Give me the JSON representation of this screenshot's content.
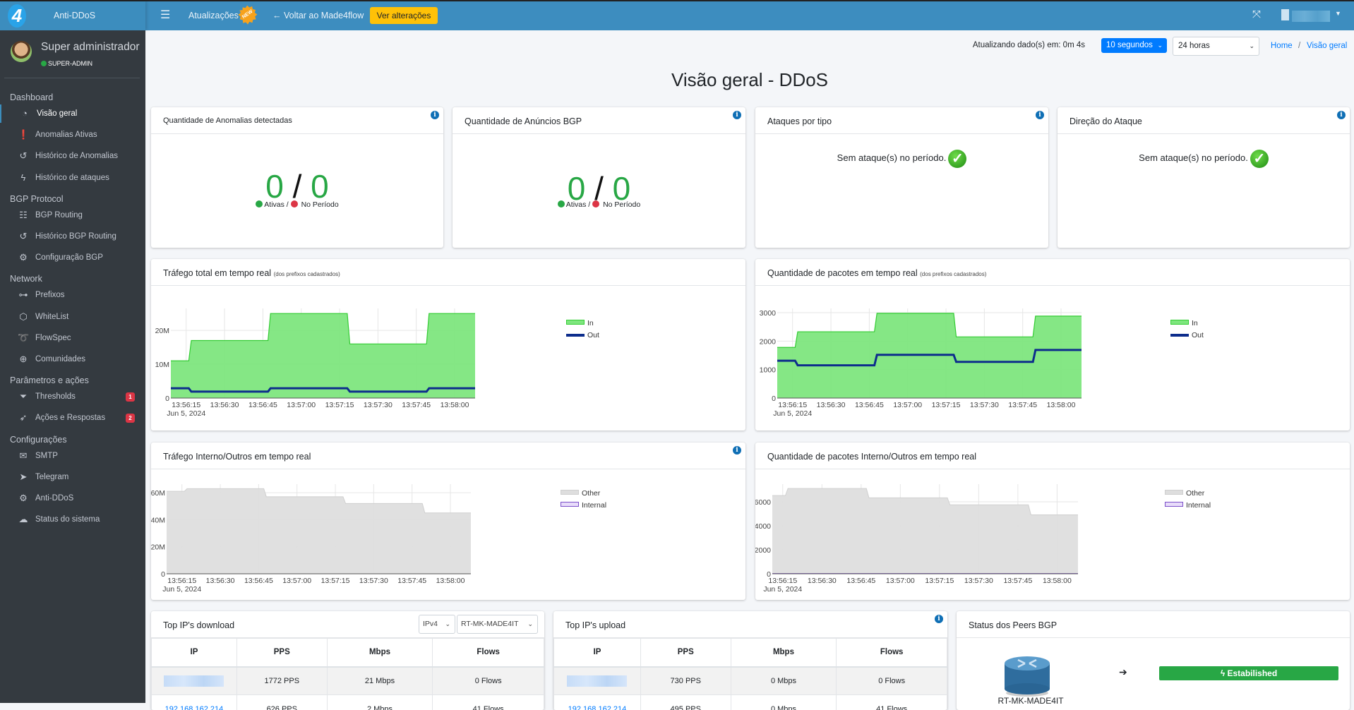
{
  "app": {
    "name": "Anti-DDoS",
    "logo": "4"
  },
  "topbar": {
    "menu_icon": "hamburger-icon",
    "updates_label": "Atualizações",
    "new_badge": "NEW",
    "back_label": "← Voltar ao Made4flow",
    "changes_button": "Ver alterações",
    "fullscreen_icon": "expand-icon",
    "company_icon": "building-icon"
  },
  "user": {
    "name": "Super administrador",
    "role": "SUPER-ADMIN"
  },
  "sidebar": {
    "sections": [
      {
        "title": "Dashboard",
        "items": [
          {
            "label": "Visão geral",
            "icon": "tachometer-icon",
            "active": true
          },
          {
            "label": "Anomalias Ativas",
            "icon": "exclamation-circle-icon"
          },
          {
            "label": "Histórico de Anomalias",
            "icon": "history-icon"
          },
          {
            "label": "Histórico de ataques",
            "icon": "bolt-icon"
          }
        ]
      },
      {
        "title": "BGP Protocol",
        "items": [
          {
            "label": "BGP Routing",
            "icon": "sitemap-icon"
          },
          {
            "label": "Histórico BGP Routing",
            "icon": "history-icon"
          },
          {
            "label": "Configuração BGP",
            "icon": "gear-icon"
          }
        ]
      },
      {
        "title": "Network",
        "items": [
          {
            "label": "Prefixos",
            "icon": "project-diagram-icon"
          },
          {
            "label": "WhiteList",
            "icon": "hexagon-icon"
          },
          {
            "label": "FlowSpec",
            "icon": "route-icon"
          },
          {
            "label": "Comunidades",
            "icon": "globe-icon"
          }
        ]
      },
      {
        "title": "Parâmetros e ações",
        "items": [
          {
            "label": "Thresholds",
            "icon": "filter-icon",
            "badge": "1"
          },
          {
            "label": "Ações e Respostas",
            "icon": "rocket-icon",
            "badge": "2"
          }
        ]
      },
      {
        "title": "Configurações",
        "items": [
          {
            "label": "SMTP",
            "icon": "mail-server-icon"
          },
          {
            "label": "Telegram",
            "icon": "telegram-icon"
          },
          {
            "label": "Anti-DDoS",
            "icon": "gears-icon"
          },
          {
            "label": "Status do sistema",
            "icon": "cloud-upload-icon"
          }
        ]
      }
    ]
  },
  "toolbar": {
    "refresh_text": "Atualizando dado(s) em: 0m 4s",
    "interval_select": "10 segundos",
    "period_select": "24 horas",
    "breadcrumb": [
      "Home",
      "/",
      "Visão geral"
    ]
  },
  "page_title": "Visão geral - DDoS",
  "cards": {
    "anomalies": {
      "title": "Quantidade de Anomalias detectadas",
      "active": "0",
      "period": "0",
      "sep": "/",
      "legend_active": "Ativas /",
      "legend_period": "No Período"
    },
    "bgp_ads": {
      "title": "Quantidade de Anúncios BGP",
      "active": "0",
      "period": "0",
      "sep": "/",
      "legend_active": "Ativas /",
      "legend_period": "No Período"
    },
    "attack_types": {
      "title": "Ataques por tipo",
      "message": "Sem ataque(s) no período."
    },
    "attack_direction": {
      "title": "Direção do Ataque",
      "message": "Sem ataque(s) no período."
    }
  },
  "colors": {
    "green": "#28a745",
    "red": "#dc3545",
    "in_fill": "#7ee67e",
    "in_line": "#33cc33",
    "out_line": "#0d2d8c",
    "other_fill": "#dedede",
    "internal_fill": "#e8dcfa",
    "accent": "#3d8dbf"
  },
  "chart_data": [
    {
      "id": "traffic",
      "type": "area",
      "title": "Tráfego total em tempo real",
      "subtitle": "(dos prefixos cadastrados)",
      "xlim": [
        "13:56:09",
        "13:58:08"
      ],
      "ylim": [
        0,
        26500000
      ],
      "xticks": [
        "13:56:15",
        "13:56:30",
        "13:56:45",
        "13:57:00",
        "13:57:15",
        "13:57:30",
        "13:57:45",
        "13:58:00"
      ],
      "date_label": "Jun 5, 2024",
      "yticks": [
        0,
        10000000,
        20000000
      ],
      "ytick_labels": [
        "0",
        "10M",
        "20M"
      ],
      "grid": true,
      "legend": "right",
      "series": [
        {
          "name": "In",
          "style": "area",
          "x": [
            "13:56:09",
            "13:56:16",
            "13:56:17",
            "13:56:47",
            "13:56:48",
            "13:57:18",
            "13:57:19",
            "13:57:49",
            "13:57:50",
            "13:58:08"
          ],
          "values": [
            11000000,
            11000000,
            17000000,
            17000000,
            25000000,
            25000000,
            16000000,
            16000000,
            25000000,
            25000000
          ]
        },
        {
          "name": "Out",
          "style": "line",
          "x": [
            "13:56:09",
            "13:56:16",
            "13:56:17",
            "13:56:47",
            "13:56:48",
            "13:57:18",
            "13:57:19",
            "13:57:49",
            "13:57:50",
            "13:58:08"
          ],
          "values": [
            2900000,
            2900000,
            1900000,
            1900000,
            2900000,
            2900000,
            1900000,
            1900000,
            2900000,
            2900000
          ]
        }
      ]
    },
    {
      "id": "packets",
      "type": "area",
      "title": "Quantidade de pacotes em tempo real",
      "subtitle": "(dos prefixos cadastrados)",
      "xlim": [
        "13:56:09",
        "13:58:08"
      ],
      "ylim": [
        0,
        3150
      ],
      "xticks": [
        "13:56:15",
        "13:56:30",
        "13:56:45",
        "13:57:00",
        "13:57:15",
        "13:57:30",
        "13:57:45",
        "13:58:00"
      ],
      "date_label": "Jun 5, 2024",
      "yticks": [
        0,
        1000,
        2000,
        3000
      ],
      "ytick_labels": [
        "0",
        "1000",
        "2000",
        "3000"
      ],
      "grid": true,
      "legend": "right",
      "series": [
        {
          "name": "In",
          "style": "area",
          "x": [
            "13:56:09",
            "13:56:16",
            "13:56:17",
            "13:56:47",
            "13:56:48",
            "13:57:18",
            "13:57:19",
            "13:57:49",
            "13:57:50",
            "13:58:08"
          ],
          "values": [
            1780,
            1780,
            2330,
            2330,
            2980,
            2980,
            2150,
            2150,
            2880,
            2880
          ]
        },
        {
          "name": "Out",
          "style": "line",
          "x": [
            "13:56:09",
            "13:56:16",
            "13:56:17",
            "13:56:47",
            "13:56:48",
            "13:57:18",
            "13:57:19",
            "13:57:49",
            "13:57:50",
            "13:58:08"
          ],
          "values": [
            1310,
            1310,
            1150,
            1150,
            1520,
            1520,
            1270,
            1270,
            1690,
            1690
          ]
        }
      ]
    },
    {
      "id": "traffic_internal",
      "type": "area",
      "title": "Tráfego Interno/Outros em tempo real",
      "xlim": [
        "13:56:09",
        "13:58:08"
      ],
      "ylim": [
        0,
        66300000
      ],
      "xticks": [
        "13:56:15",
        "13:56:30",
        "13:56:45",
        "13:57:00",
        "13:57:15",
        "13:57:30",
        "13:57:45",
        "13:58:00"
      ],
      "date_label": "Jun 5, 2024",
      "yticks": [
        0,
        20000000,
        40000000,
        60000000
      ],
      "ytick_labels": [
        "0",
        "20M",
        "40M",
        "60M"
      ],
      "grid": true,
      "legend": "right",
      "series": [
        {
          "name": "Other",
          "style": "area-gray",
          "x": [
            "13:56:09",
            "13:56:16",
            "13:56:17",
            "13:56:47",
            "13:56:48",
            "13:57:18",
            "13:57:19",
            "13:57:49",
            "13:57:50",
            "13:58:08"
          ],
          "values": [
            61000000,
            61000000,
            63000000,
            63000000,
            57000000,
            57000000,
            52000000,
            52000000,
            45000000,
            45000000
          ]
        },
        {
          "name": "Internal",
          "style": "area-purple",
          "x": [
            "13:56:09",
            "13:58:08"
          ],
          "values": [
            0,
            0
          ]
        }
      ]
    },
    {
      "id": "packets_internal",
      "type": "area",
      "title": "Quantidade de pacotes Interno/Outros em tempo real",
      "xlim": [
        "13:56:11",
        "13:58:08"
      ],
      "ylim": [
        0,
        7470
      ],
      "xticks": [
        "13:56:15",
        "13:56:30",
        "13:56:45",
        "13:57:00",
        "13:57:15",
        "13:57:30",
        "13:57:45",
        "13:58:00"
      ],
      "date_label": "Jun 5, 2024",
      "yticks": [
        0,
        2000,
        4000,
        6000
      ],
      "ytick_labels": [
        "0",
        "2000",
        "4000",
        "6000"
      ],
      "grid": true,
      "legend": "right",
      "series": [
        {
          "name": "Other",
          "style": "area-gray",
          "x": [
            "13:56:11",
            "13:56:16",
            "13:56:17",
            "13:56:47",
            "13:56:48",
            "13:57:18",
            "13:57:19",
            "13:57:49",
            "13:57:50",
            "13:58:08"
          ],
          "values": [
            6520,
            6520,
            7110,
            7110,
            6330,
            6330,
            5750,
            5750,
            4910,
            4910
          ]
        },
        {
          "name": "Internal",
          "style": "area-purple",
          "x": [
            "13:56:11",
            "13:58:08"
          ],
          "values": [
            20,
            20
          ]
        }
      ]
    }
  ],
  "top_download": {
    "title": "Top IP's download",
    "ip_version": "IPv4",
    "router": "RT-MK-MADE4IT",
    "columns": [
      "IP",
      "PPS",
      "Mbps",
      "Flows"
    ],
    "rows": [
      [
        "",
        "1772 PPS",
        "21 Mbps",
        "0 Flows"
      ],
      [
        "192.168.162.214",
        "626 PPS",
        "2 Mbps",
        "41 Flows"
      ]
    ]
  },
  "top_upload": {
    "title": "Top IP's upload",
    "columns": [
      "IP",
      "PPS",
      "Mbps",
      "Flows"
    ],
    "rows": [
      [
        "",
        "730 PPS",
        "0 Mbps",
        "0 Flows"
      ],
      [
        "192.168.162.214",
        "495 PPS",
        "0 Mbps",
        "41 Flows"
      ]
    ]
  },
  "bgp_peers": {
    "title": "Status dos Peers BGP",
    "router": "RT-MK-MADE4IT",
    "status": "Estabilished",
    "status_icon": "bolt-icon",
    "router_icon": "router-icon"
  }
}
